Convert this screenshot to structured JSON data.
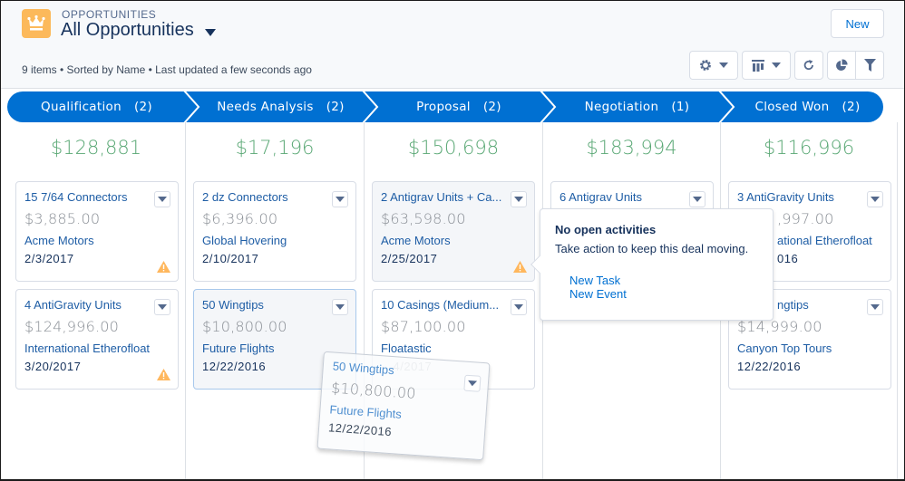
{
  "header": {
    "object_label": "OPPORTUNITIES",
    "list_view_title": "All Opportunities",
    "meta": "9 items • Sorted by Name • Last updated a few seconds ago",
    "new_button": "New",
    "toolbar": {
      "settings_icon": "gear-icon",
      "display_as_icon": "kanban-columns-icon",
      "refresh_icon": "refresh-icon",
      "charts_icon": "pie-chart-icon",
      "filter_icon": "filter-icon"
    },
    "app_icon": "crown-icon"
  },
  "stages": [
    {
      "name": "Qualification",
      "count": "(2)",
      "total": "$128,881"
    },
    {
      "name": "Needs Analysis",
      "count": "(2)",
      "total": "$17,196"
    },
    {
      "name": "Proposal",
      "count": "(2)",
      "total": "$150,698"
    },
    {
      "name": "Negotiation",
      "count": "(1)",
      "total": "$183,994"
    },
    {
      "name": "Closed Won",
      "count": "(2)",
      "total": "$116,996"
    }
  ],
  "cards": {
    "qualification": [
      {
        "title": "15 7/64 Connectors",
        "amount": "$3,885.00",
        "account": "Acme Motors",
        "date": "2/3/2017",
        "warning": true
      },
      {
        "title": "4 AntiGravity Units",
        "amount": "$124,996.00",
        "account": "International Etherofloat",
        "date": "3/20/2017",
        "warning": true
      }
    ],
    "needs_analysis": [
      {
        "title": "2 dz Connectors",
        "amount": "$6,396.00",
        "account": "Global Hovering",
        "date": "2/10/2017",
        "warning": false
      },
      {
        "title": "50 Wingtips",
        "amount": "$10,800.00",
        "account": "Future Flights",
        "date": "12/22/2016",
        "warning": false
      }
    ],
    "proposal": [
      {
        "title": "2 Antigrav Units + Ca...",
        "amount": "$63,598.00",
        "account": "Acme Motors",
        "date": "2/25/2017",
        "warning": true
      },
      {
        "title": "10 Casings (Medium...",
        "amount": "$87,100.00",
        "account": "Floatastic",
        "date": "…4/2017",
        "warning": false
      }
    ],
    "negotiation": [
      {
        "title": "6 Antigrav Units"
      }
    ],
    "closed_won": [
      {
        "title": "3 AntiGravity Units",
        "amount": ",997.00",
        "account": "ational Etherofloat",
        "date": "016"
      },
      {
        "title": "ngtips",
        "amount": "$14,999.00",
        "account": "Canyon Top Tours",
        "date": "12/22/2016"
      }
    ]
  },
  "drag_ghost": {
    "title": "50 Wingtips",
    "amount": "$10,800.00",
    "account": "Future Flights",
    "date": "12/22/2016"
  },
  "popover": {
    "title": "No open activities",
    "body": "Take action to keep this deal moving.",
    "links": [
      "New Task",
      "New Event"
    ]
  },
  "colors": {
    "path_blue": "#0070d2",
    "total_green": "#5aa875",
    "link_blue": "#1e5da5",
    "warning_orange": "#ffb75d",
    "app_icon_orange": "#fcb95b"
  }
}
